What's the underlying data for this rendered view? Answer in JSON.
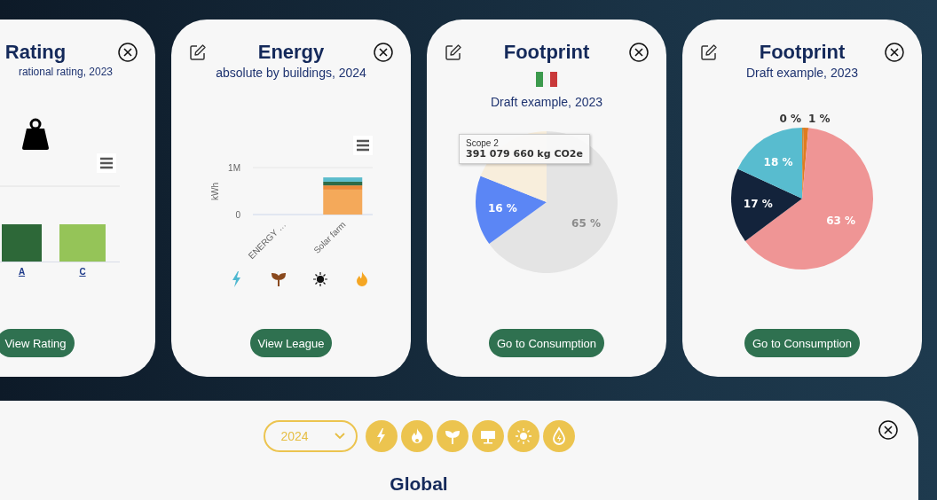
{
  "cards": [
    {
      "kind": "rating",
      "title": "Rating",
      "subtitle": "rational rating, 2023",
      "flag": false,
      "grade_links": [
        "A",
        "C"
      ],
      "button": "View Rating"
    },
    {
      "kind": "bar",
      "title": "Energy",
      "subtitle": "absolute by buildings, 2024",
      "editable": true,
      "flag": false,
      "chart_data": {
        "type": "bar",
        "ylabel": "kWh",
        "categories": [
          "ENERGY …",
          "Solar farm"
        ],
        "stacked": true,
        "ylim": [
          0,
          1000000
        ],
        "yticks": [
          0,
          {
            "value": 1000000,
            "label": "1M"
          }
        ],
        "series": [
          {
            "color": "#f4a95a",
            "values": [
              0,
              530000
            ]
          },
          {
            "color": "#ee8a3a",
            "values": [
              0,
              90000
            ]
          },
          {
            "color": "#2f6b47",
            "values": [
              0,
              80000
            ]
          },
          {
            "color": "#5bbccc",
            "values": [
              0,
              90000
            ]
          }
        ]
      },
      "legend": [
        {
          "kind": "bolt",
          "color": "#4fb8d0"
        },
        {
          "kind": "sprout",
          "color": "#8a4a1e"
        },
        {
          "kind": "sun",
          "color": "#111111"
        },
        {
          "kind": "flame",
          "color": "#f5a623"
        }
      ],
      "button": "View League"
    },
    {
      "kind": "pie",
      "title": "Footprint",
      "subtitle": "Draft example, 2023",
      "editable": true,
      "flag": true,
      "chart_data": {
        "type": "pie",
        "values": [
          65,
          16,
          19
        ],
        "value_labels": [
          "65 %",
          "16 %",
          null
        ],
        "colors": [
          "#e4e4e4",
          "#5b86f5",
          "#f8eedc"
        ]
      },
      "tooltip": {
        "label": "Scope 2",
        "value": "391 079 660 kg CO2e"
      },
      "button": "Go to Consumption"
    },
    {
      "kind": "pie",
      "title": "Footprint",
      "subtitle": "Draft example, 2023",
      "editable": true,
      "flag": false,
      "chart_data": {
        "type": "pie",
        "values": [
          0.4,
          1,
          63,
          17,
          18
        ],
        "value_labels": [
          "0 %",
          "1 %",
          "63 %",
          "17 %",
          "18 %"
        ],
        "colors": [
          "#c98a3a",
          "#e07b20",
          "#ef9595",
          "#13233b",
          "#58bccf"
        ]
      },
      "button": "Go to Consumption"
    }
  ],
  "panel": {
    "year_select": {
      "value": "2024"
    },
    "filters": [
      {
        "kind": "bolt"
      },
      {
        "kind": "flame"
      },
      {
        "kind": "sprout"
      },
      {
        "kind": "solar"
      },
      {
        "kind": "sun"
      },
      {
        "kind": "drop"
      }
    ],
    "title": "Global"
  }
}
